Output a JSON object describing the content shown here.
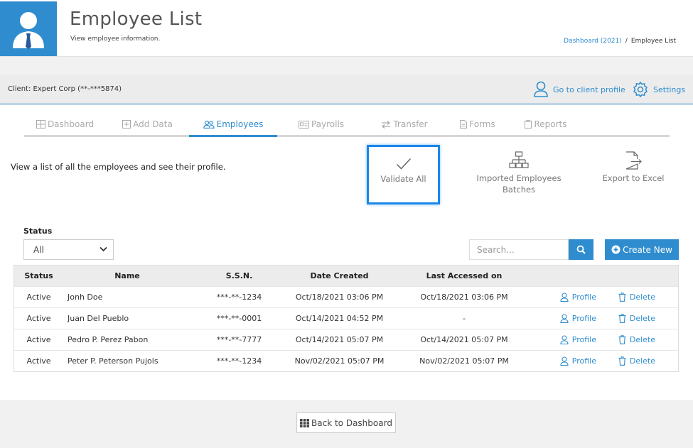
{
  "header": {
    "title": "Employee List",
    "subtitle": "View employee information.",
    "breadcrumb": {
      "link": "Dashboard (2021)",
      "separator": "/",
      "current": "Employee List"
    }
  },
  "client_bar": {
    "client_label": "Client: Expert Corp (**-***5874)",
    "profile_link": "Go to client profile",
    "settings_link": "Settings"
  },
  "tabs": [
    {
      "label": "Dashboard",
      "icon": "dashboard-icon",
      "active": false
    },
    {
      "label": "Add Data",
      "icon": "plus-box-icon",
      "active": false
    },
    {
      "label": "Employees",
      "icon": "users-icon",
      "active": true
    },
    {
      "label": "Payrolls",
      "icon": "id-card-icon",
      "active": false
    },
    {
      "label": "Transfer",
      "icon": "transfer-icon",
      "active": false
    },
    {
      "label": "Forms",
      "icon": "document-icon",
      "active": false
    },
    {
      "label": "Reports",
      "icon": "clipboard-icon",
      "active": false
    }
  ],
  "intro_text": "View a list of all the employees and see their profile.",
  "actions": {
    "validate_all": "Validate All",
    "imported_batches_line1": "Imported Employees",
    "imported_batches_line2": "Batches",
    "export_excel": "Export to Excel"
  },
  "filters": {
    "status_label": "Status",
    "status_value": "All",
    "search_placeholder": "Search...",
    "create_new": "Create New"
  },
  "table": {
    "headers": [
      "Status",
      "Name",
      "S.S.N.",
      "Date Created",
      "Last Accessed on"
    ],
    "profile_label": "Profile",
    "delete_label": "Delete",
    "rows": [
      {
        "status": "Active",
        "name": "Jonh Doe",
        "ssn": "***-**-1234",
        "created": "Oct/18/2021 03:06 PM",
        "last": "Oct/18/2021 03:06 PM"
      },
      {
        "status": "Active",
        "name": "Juan Del Pueblo",
        "ssn": "***-**-0001",
        "created": "Oct/14/2021 04:52 PM",
        "last": "-"
      },
      {
        "status": "Active",
        "name": "Pedro P. Perez Pabon",
        "ssn": "***-**-7777",
        "created": "Oct/14/2021 05:07 PM",
        "last": "Oct/14/2021 05:07 PM"
      },
      {
        "status": "Active",
        "name": "Peter P. Peterson Pujols",
        "ssn": "***-**-1234",
        "created": "Nov/02/2021 05:07 PM",
        "last": "Nov/02/2021 05:07 PM"
      }
    ]
  },
  "footer": {
    "back_label": "Back to Dashboard"
  },
  "colors": {
    "accent": "#2f8dcf",
    "highlight": "#1a87e8"
  }
}
